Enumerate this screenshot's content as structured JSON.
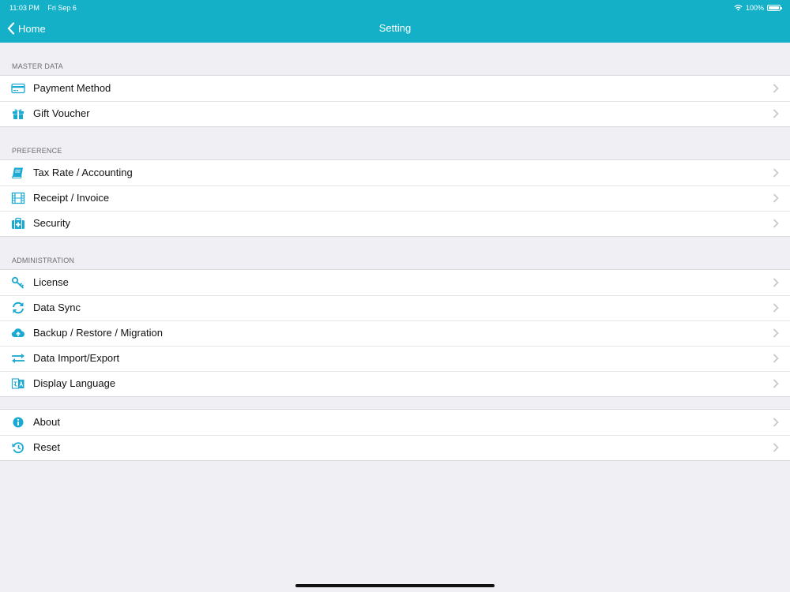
{
  "status_bar": {
    "time": "11:03 PM",
    "date": "Fri Sep 6",
    "battery": "100%"
  },
  "nav": {
    "back_label": "Home",
    "title": "Setting"
  },
  "colors": {
    "accent": "#14b0c8",
    "icon": "#1aa9d1",
    "background": "#efeff4"
  },
  "sections": [
    {
      "header": "MASTER DATA",
      "items": [
        {
          "label": "Payment Method",
          "icon": "credit-card-icon"
        },
        {
          "label": "Gift Voucher",
          "icon": "gift-icon"
        }
      ]
    },
    {
      "header": "PREFERENCE",
      "items": [
        {
          "label": "Tax Rate / Accounting",
          "icon": "book-icon"
        },
        {
          "label": "Receipt / Invoice",
          "icon": "film-icon"
        },
        {
          "label": "Security",
          "icon": "medical-kit-icon"
        }
      ]
    },
    {
      "header": "ADMINISTRATION",
      "items": [
        {
          "label": "License",
          "icon": "key-icon"
        },
        {
          "label": "Data Sync",
          "icon": "sync-icon"
        },
        {
          "label": "Backup / Restore / Migration",
          "icon": "cloud-upload-icon"
        },
        {
          "label": "Data Import/Export",
          "icon": "exchange-arrows-icon"
        },
        {
          "label": "Display Language",
          "icon": "language-icon"
        }
      ]
    },
    {
      "header": "",
      "items": [
        {
          "label": "About",
          "icon": "info-icon"
        },
        {
          "label": "Reset",
          "icon": "history-icon"
        }
      ]
    }
  ]
}
